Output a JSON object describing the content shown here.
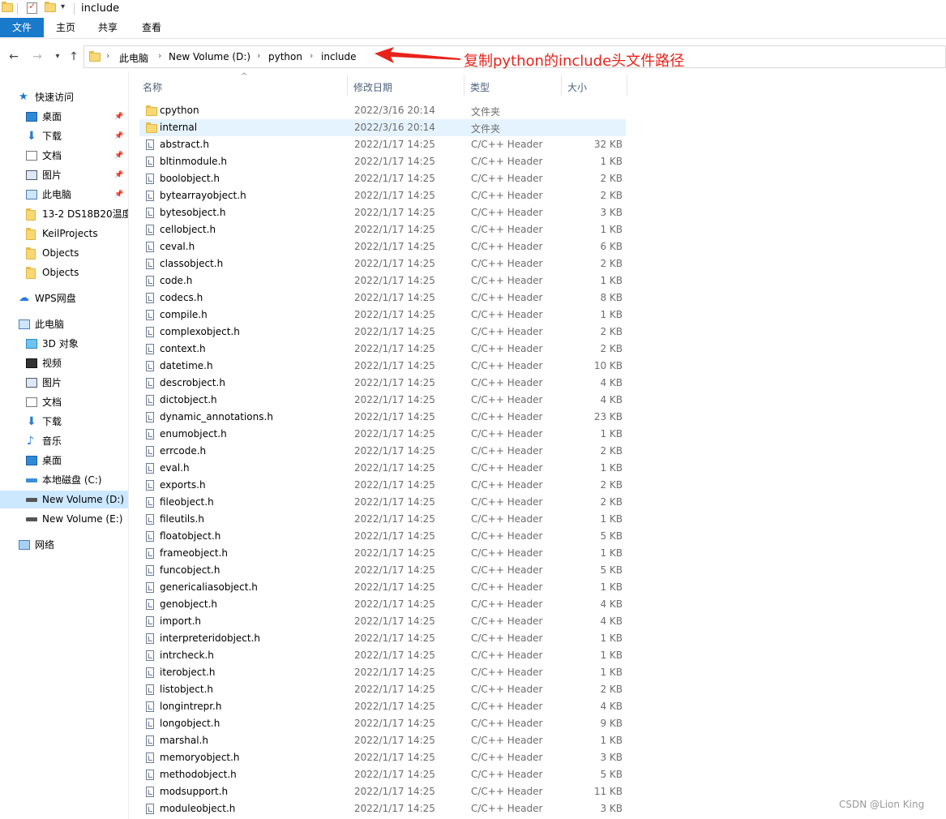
{
  "window": {
    "title": "include"
  },
  "ribbon": {
    "tabs": [
      "文件",
      "主页",
      "共享",
      "查看"
    ]
  },
  "address": {
    "crumbs": [
      "此电脑",
      "New Volume (D:)",
      "python",
      "include"
    ]
  },
  "annotation": {
    "text": "复制python的include头文件路径",
    "color": "#e8231c"
  },
  "nav": {
    "quick_access": "快速访问",
    "quick_items": [
      "桌面",
      "下载",
      "文档",
      "图片",
      "此电脑",
      "13-2 DS18B20温度",
      "KeilProjects",
      "Objects",
      "Objects"
    ],
    "wps": "WPS网盘",
    "this_pc": "此电脑",
    "pc_items": [
      "3D 对象",
      "视频",
      "图片",
      "文档",
      "下载",
      "音乐",
      "桌面",
      "本地磁盘 (C:)",
      "New Volume (D:)",
      "New Volume (E:)"
    ],
    "network": "网络"
  },
  "columns": {
    "name": "名称",
    "date": "修改日期",
    "type": "类型",
    "size": "大小"
  },
  "files": [
    {
      "name": "cpython",
      "date": "2022/3/16 20:14",
      "type": "文件夹",
      "size": "",
      "kind": "folder"
    },
    {
      "name": "internal",
      "date": "2022/3/16 20:14",
      "type": "文件夹",
      "size": "",
      "kind": "folder"
    },
    {
      "name": "abstract.h",
      "date": "2022/1/17 14:25",
      "type": "C/C++ Header",
      "size": "32 KB",
      "kind": "file"
    },
    {
      "name": "bltinmodule.h",
      "date": "2022/1/17 14:25",
      "type": "C/C++ Header",
      "size": "1 KB",
      "kind": "file"
    },
    {
      "name": "boolobject.h",
      "date": "2022/1/17 14:25",
      "type": "C/C++ Header",
      "size": "2 KB",
      "kind": "file"
    },
    {
      "name": "bytearrayobject.h",
      "date": "2022/1/17 14:25",
      "type": "C/C++ Header",
      "size": "2 KB",
      "kind": "file"
    },
    {
      "name": "bytesobject.h",
      "date": "2022/1/17 14:25",
      "type": "C/C++ Header",
      "size": "3 KB",
      "kind": "file"
    },
    {
      "name": "cellobject.h",
      "date": "2022/1/17 14:25",
      "type": "C/C++ Header",
      "size": "1 KB",
      "kind": "file"
    },
    {
      "name": "ceval.h",
      "date": "2022/1/17 14:25",
      "type": "C/C++ Header",
      "size": "6 KB",
      "kind": "file"
    },
    {
      "name": "classobject.h",
      "date": "2022/1/17 14:25",
      "type": "C/C++ Header",
      "size": "2 KB",
      "kind": "file"
    },
    {
      "name": "code.h",
      "date": "2022/1/17 14:25",
      "type": "C/C++ Header",
      "size": "1 KB",
      "kind": "file"
    },
    {
      "name": "codecs.h",
      "date": "2022/1/17 14:25",
      "type": "C/C++ Header",
      "size": "8 KB",
      "kind": "file"
    },
    {
      "name": "compile.h",
      "date": "2022/1/17 14:25",
      "type": "C/C++ Header",
      "size": "1 KB",
      "kind": "file"
    },
    {
      "name": "complexobject.h",
      "date": "2022/1/17 14:25",
      "type": "C/C++ Header",
      "size": "2 KB",
      "kind": "file"
    },
    {
      "name": "context.h",
      "date": "2022/1/17 14:25",
      "type": "C/C++ Header",
      "size": "2 KB",
      "kind": "file"
    },
    {
      "name": "datetime.h",
      "date": "2022/1/17 14:25",
      "type": "C/C++ Header",
      "size": "10 KB",
      "kind": "file"
    },
    {
      "name": "descrobject.h",
      "date": "2022/1/17 14:25",
      "type": "C/C++ Header",
      "size": "4 KB",
      "kind": "file"
    },
    {
      "name": "dictobject.h",
      "date": "2022/1/17 14:25",
      "type": "C/C++ Header",
      "size": "4 KB",
      "kind": "file"
    },
    {
      "name": "dynamic_annotations.h",
      "date": "2022/1/17 14:25",
      "type": "C/C++ Header",
      "size": "23 KB",
      "kind": "file"
    },
    {
      "name": "enumobject.h",
      "date": "2022/1/17 14:25",
      "type": "C/C++ Header",
      "size": "1 KB",
      "kind": "file"
    },
    {
      "name": "errcode.h",
      "date": "2022/1/17 14:25",
      "type": "C/C++ Header",
      "size": "2 KB",
      "kind": "file"
    },
    {
      "name": "eval.h",
      "date": "2022/1/17 14:25",
      "type": "C/C++ Header",
      "size": "1 KB",
      "kind": "file"
    },
    {
      "name": "exports.h",
      "date": "2022/1/17 14:25",
      "type": "C/C++ Header",
      "size": "2 KB",
      "kind": "file"
    },
    {
      "name": "fileobject.h",
      "date": "2022/1/17 14:25",
      "type": "C/C++ Header",
      "size": "2 KB",
      "kind": "file"
    },
    {
      "name": "fileutils.h",
      "date": "2022/1/17 14:25",
      "type": "C/C++ Header",
      "size": "1 KB",
      "kind": "file"
    },
    {
      "name": "floatobject.h",
      "date": "2022/1/17 14:25",
      "type": "C/C++ Header",
      "size": "5 KB",
      "kind": "file"
    },
    {
      "name": "frameobject.h",
      "date": "2022/1/17 14:25",
      "type": "C/C++ Header",
      "size": "1 KB",
      "kind": "file"
    },
    {
      "name": "funcobject.h",
      "date": "2022/1/17 14:25",
      "type": "C/C++ Header",
      "size": "5 KB",
      "kind": "file"
    },
    {
      "name": "genericaliasobject.h",
      "date": "2022/1/17 14:25",
      "type": "C/C++ Header",
      "size": "1 KB",
      "kind": "file"
    },
    {
      "name": "genobject.h",
      "date": "2022/1/17 14:25",
      "type": "C/C++ Header",
      "size": "4 KB",
      "kind": "file"
    },
    {
      "name": "import.h",
      "date": "2022/1/17 14:25",
      "type": "C/C++ Header",
      "size": "4 KB",
      "kind": "file"
    },
    {
      "name": "interpreteridobject.h",
      "date": "2022/1/17 14:25",
      "type": "C/C++ Header",
      "size": "1 KB",
      "kind": "file"
    },
    {
      "name": "intrcheck.h",
      "date": "2022/1/17 14:25",
      "type": "C/C++ Header",
      "size": "1 KB",
      "kind": "file"
    },
    {
      "name": "iterobject.h",
      "date": "2022/1/17 14:25",
      "type": "C/C++ Header",
      "size": "1 KB",
      "kind": "file"
    },
    {
      "name": "listobject.h",
      "date": "2022/1/17 14:25",
      "type": "C/C++ Header",
      "size": "2 KB",
      "kind": "file"
    },
    {
      "name": "longintrepr.h",
      "date": "2022/1/17 14:25",
      "type": "C/C++ Header",
      "size": "4 KB",
      "kind": "file"
    },
    {
      "name": "longobject.h",
      "date": "2022/1/17 14:25",
      "type": "C/C++ Header",
      "size": "9 KB",
      "kind": "file"
    },
    {
      "name": "marshal.h",
      "date": "2022/1/17 14:25",
      "type": "C/C++ Header",
      "size": "1 KB",
      "kind": "file"
    },
    {
      "name": "memoryobject.h",
      "date": "2022/1/17 14:25",
      "type": "C/C++ Header",
      "size": "3 KB",
      "kind": "file"
    },
    {
      "name": "methodobject.h",
      "date": "2022/1/17 14:25",
      "type": "C/C++ Header",
      "size": "5 KB",
      "kind": "file"
    },
    {
      "name": "modsupport.h",
      "date": "2022/1/17 14:25",
      "type": "C/C++ Header",
      "size": "11 KB",
      "kind": "file"
    },
    {
      "name": "moduleobject.h",
      "date": "2022/1/17 14:25",
      "type": "C/C++ Header",
      "size": "3 KB",
      "kind": "file"
    }
  ],
  "watermark": "CSDN @Lion King"
}
